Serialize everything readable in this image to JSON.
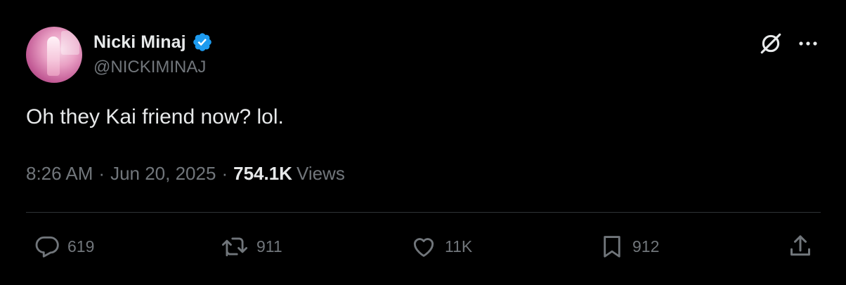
{
  "author": {
    "display_name": "Nicki Minaj",
    "handle": "@NICKIMINAJ",
    "verified": true
  },
  "icons": {
    "verified": "verified-badge-icon",
    "grok": "grok-icon",
    "more": "more-icon",
    "reply": "reply-icon",
    "retweet": "retweet-icon",
    "like": "like-icon",
    "bookmark": "bookmark-icon",
    "share": "share-icon"
  },
  "tweet": {
    "text": "Oh they Kai friend now? lol.",
    "time": "8:26 AM",
    "separator": "·",
    "date": "Jun 20, 2025",
    "views_count": "754.1K",
    "views_label": "Views"
  },
  "actions": {
    "replies": "619",
    "retweets": "911",
    "likes": "11K",
    "bookmarks": "912"
  },
  "colors": {
    "background": "#000000",
    "primary_text": "#e7e9ea",
    "secondary_text": "#71767b",
    "verified_badge": "#1d9bf0",
    "divider": "#2f3336"
  }
}
